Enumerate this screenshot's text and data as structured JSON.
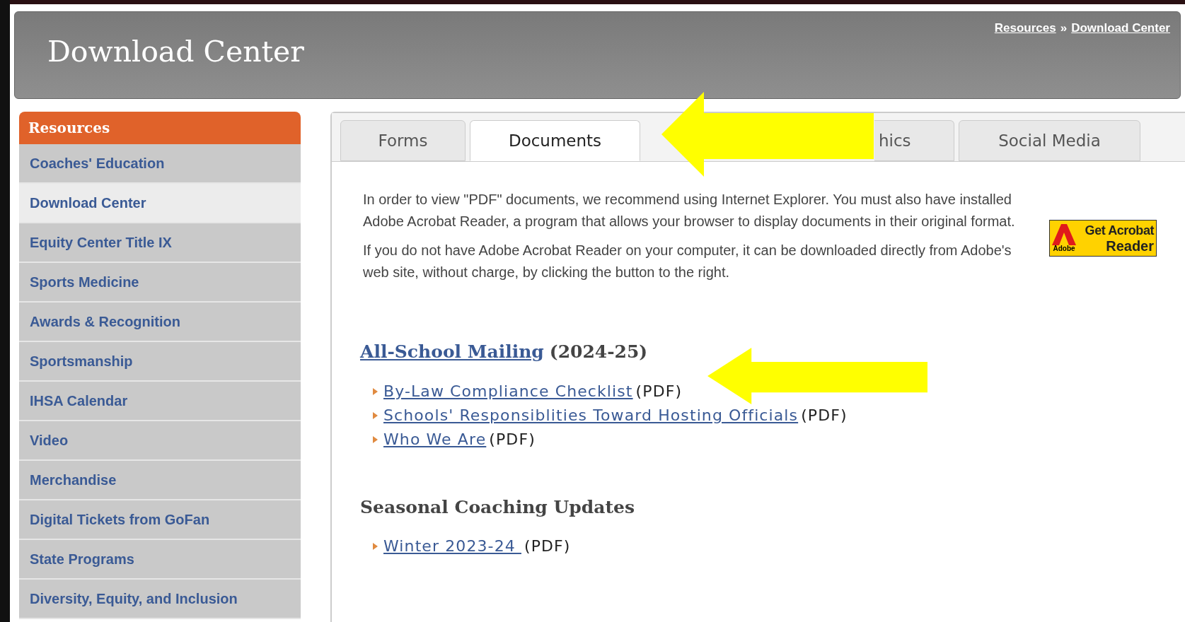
{
  "header": {
    "title": "Download Center",
    "breadcrumb": [
      {
        "label": "Resources"
      },
      {
        "label": "Download Center"
      }
    ],
    "breadcrumb_separator": "»"
  },
  "sidebar": {
    "title": "Resources",
    "items": [
      {
        "label": "Coaches' Education",
        "selected": false
      },
      {
        "label": "Download Center",
        "selected": true
      },
      {
        "label": "Equity Center Title IX",
        "selected": false
      },
      {
        "label": "Sports Medicine",
        "selected": false
      },
      {
        "label": "Awards & Recognition",
        "selected": false
      },
      {
        "label": "Sportsmanship",
        "selected": false
      },
      {
        "label": "IHSA Calendar",
        "selected": false
      },
      {
        "label": "Video",
        "selected": false
      },
      {
        "label": "Merchandise",
        "selected": false
      },
      {
        "label": "Digital Tickets from GoFan",
        "selected": false
      },
      {
        "label": "State Programs",
        "selected": false
      },
      {
        "label": "Diversity, Equity, and Inclusion",
        "selected": false
      }
    ]
  },
  "tabs": [
    {
      "label": "Forms",
      "selected": false
    },
    {
      "label": "Documents",
      "selected": true
    },
    {
      "label": "hics",
      "selected": false
    },
    {
      "label": "Social Media",
      "selected": false
    }
  ],
  "intro": [
    "In order to view \"PDF\" documents, we recommend using Internet Explorer. You must also have installed Adobe Acrobat Reader, a program that allows your browser to display documents in their original format.",
    "If you do not have Adobe Acrobat Reader on your computer, it can be downloaded directly from Adobe's web site, without charge, by clicking the button to the right."
  ],
  "acrobat_badge": {
    "line1": "Get Acrobat",
    "line2": "Reader",
    "brand": "Adobe"
  },
  "sections": [
    {
      "title_link": "All-School Mailing",
      "title_suffix": "(2024-25)",
      "links": [
        {
          "label": "By-Law Compliance Checklist",
          "suffix": "(PDF)"
        },
        {
          "label": "Schools' Responsiblities Toward Hosting Officials",
          "suffix": "(PDF)"
        },
        {
          "label": "Who We Are",
          "suffix": "(PDF)"
        }
      ]
    },
    {
      "title": "Seasonal Coaching Updates",
      "links": [
        {
          "label": "Winter 2023-24 ",
          "suffix": "(PDF)"
        }
      ]
    }
  ]
}
